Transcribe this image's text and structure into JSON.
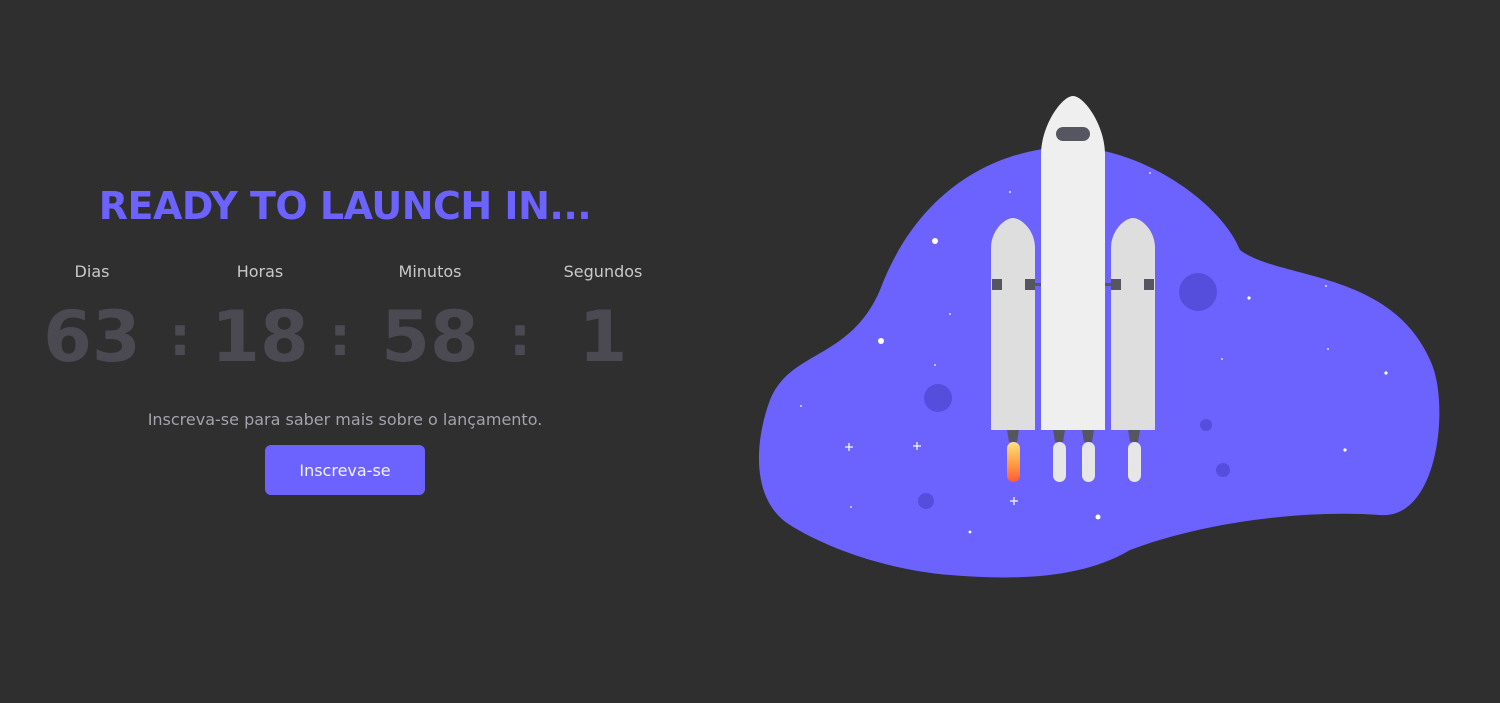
{
  "hero": {
    "title": "READY TO LAUNCH IN...",
    "subtitle": "Inscreva-se para saber mais sobre o lançamento.",
    "cta_label": "Inscreva-se",
    "accent_color": "#6c63ff"
  },
  "countdown": {
    "days_label": "Dias",
    "hours_label": "Horas",
    "minutes_label": "Minutos",
    "seconds_label": "Segundos",
    "days": "63",
    "hours": "18",
    "minutes": "58",
    "seconds": "1",
    "separator": ":"
  },
  "illustration": {
    "subject": "rocket-launch",
    "blob_color": "#6c63ff",
    "rocket_color": "#efefef",
    "planet_color": "#4f48c9"
  }
}
